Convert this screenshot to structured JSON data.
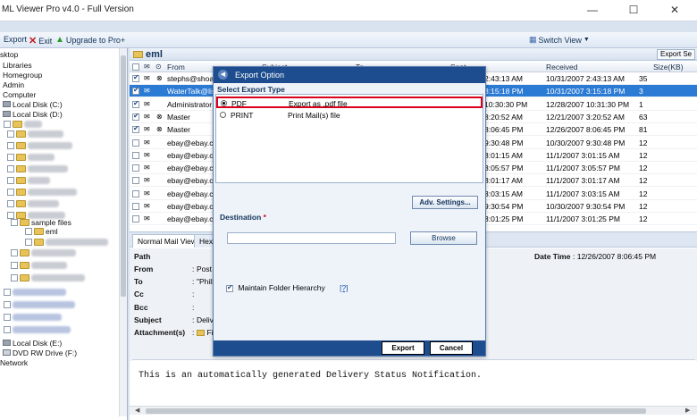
{
  "app": {
    "title": "ML Viewer Pro v4.0 - Full Version"
  },
  "toolbar": {
    "export": "Export",
    "exit": "Exit",
    "upgrade": "Upgrade to Pro+",
    "switch_view": "Switch View"
  },
  "tree": {
    "items": [
      "sktop",
      "Libraries",
      "Homegroup",
      "Admin",
      "Computer",
      "Local Disk (C:)",
      "Local Disk (D:)",
      "sample files",
      "eml",
      "Local Disk (E:)",
      "DVD RW Drive (F:)",
      "Network"
    ]
  },
  "emlpanel": {
    "folder": "eml",
    "export_selected": "Export Se"
  },
  "columns": {
    "from": "From",
    "subject": "Subject",
    "to": "To",
    "sent": "Sent",
    "received": "Received",
    "size": "Size(KB)"
  },
  "rows": [
    {
      "checked": true,
      "from": "stephs@shoals",
      "sent": "2:43:13 AM",
      "received": "10/31/2007 2:43:13 AM",
      "size": "35"
    },
    {
      "checked": true,
      "from": "WaterTalk@list",
      "sent": "3:15:18 PM",
      "received": "10/31/2007 3:15:18 PM",
      "size": "3"
    },
    {
      "checked": true,
      "from": "Administrator",
      "sent": "10:30:30 PM",
      "received": "12/28/2007 10:31:30 PM",
      "size": "1"
    },
    {
      "checked": true,
      "from": "Master",
      "sent": "3:20:52 AM",
      "received": "12/21/2007 3:20:52 AM",
      "size": "63"
    },
    {
      "checked": true,
      "from": "Master",
      "sent": "8:06:45 PM",
      "received": "12/26/2007 8:06:45 PM",
      "size": "81"
    },
    {
      "checked": false,
      "from": "ebay@ebay.cor",
      "sent": "9:30:48 PM",
      "received": "10/30/2007 9:30:48 PM",
      "size": "12"
    },
    {
      "checked": false,
      "from": "ebay@ebay.cor",
      "sent": "3:01:15 AM",
      "received": "11/1/2007 3:01:15 AM",
      "size": "12"
    },
    {
      "checked": false,
      "from": "ebay@ebay.cor",
      "sent": "3:05:57 PM",
      "received": "11/1/2007 3:05:57 PM",
      "size": "12"
    },
    {
      "checked": false,
      "from": "ebay@ebay.cor",
      "sent": "3:01:17 AM",
      "received": "11/1/2007 3:01:17 AM",
      "size": "12"
    },
    {
      "checked": false,
      "from": "ebay@ebay.cor",
      "sent": "3:03:15 AM",
      "received": "11/1/2007 3:03:15 AM",
      "size": "12"
    },
    {
      "checked": false,
      "from": "ebay@ebay.cor",
      "sent": "9:30:54 PM",
      "received": "10/30/2007 9:30:54 PM",
      "size": "12"
    },
    {
      "checked": false,
      "from": "ebay@ebay.cor",
      "sent": "3:01:25 PM",
      "received": "11/1/2007 3:01:25 PM",
      "size": "12"
    }
  ],
  "tabs": {
    "normal": "Normal Mail View",
    "hex": "Hex"
  },
  "details": {
    "path": "Path",
    "from": "From",
    "to": "To",
    "cc": "Cc",
    "bcc": "Bcc",
    "subject": "Subject",
    "attachments": "Attachment(s)",
    "colon": ":",
    "from_val": "Post",
    "to_val": "\"Phill",
    "subject_val": "Deliv",
    "attach_val": "Fi",
    "date_label": "Date Time",
    "date_val": ": 12/26/2007 8:06:45 PM"
  },
  "body_text": "This is an automatically generated Delivery Status Notification.",
  "dialog": {
    "title": "Export Option",
    "select_label": "Select Export Type",
    "options": [
      {
        "name": "PDF",
        "desc": "Export as .pdf file",
        "selected": true
      },
      {
        "name": "PRINT",
        "desc": "Print Mail(s) file",
        "selected": false
      }
    ],
    "adv_settings": "Adv. Settings...",
    "destination_label": "Destination",
    "required_mark": "*",
    "destination_value": "",
    "browse": "Browse",
    "maintain_label": "Maintain Folder Hierarchy",
    "maintain_checked": true,
    "help": "[?]",
    "export": "Export",
    "cancel": "Cancel"
  },
  "colors": {
    "title_blue": "#1d4d8e",
    "selection": "#2b7ad4",
    "highlight_red": "#d9001b"
  }
}
